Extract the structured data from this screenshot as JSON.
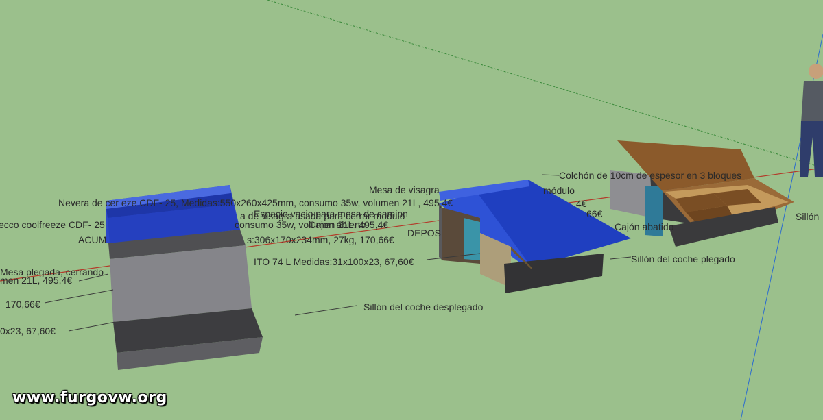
{
  "labels": {
    "nevera": "Nevera de          cer                    eze CDF- 25, Medidas:550x260x425mm, consumo 35w, volumen 21L, 495,4€",
    "nevera2": "ecco coolfreeze CDF- 25",
    "consumo": "consumo 35w, volumen 21L,  495,4€",
    "acum": "ACUM",
    "acum_medidas": "s:306x170x234mm, 27kg,  170,66€",
    "deposito": "ITO 74 L Medidas:31x100x23, 67,60€",
    "mesa_plegada": "Mesa plegada, cerrando",
    "volumen_left": "men 21L,  495,4€",
    "precio_170": "170,66€",
    "precio_67": "0x23, 67,60€",
    "sillon_desplegado": "Sillón del coche desplegado",
    "mesa_visagra": "Mesa de visagra",
    "espacio_vacio": "Espacio vacio para mesa de camion",
    "visagra_usada": "a de visagra usada para cerrar modulo",
    "cajon_abierto": "Cajon abierto",
    "depos": "DEPOS",
    "colchon": "Colchón de 10cm de espesor en 3 bloques",
    "modulo": "módulo",
    "sillon_plegado": "Sillón del coche plegado",
    "cajon_right": "Cajón abatido",
    "sillon_right": "Sillón",
    "precio_4": "4€",
    "precio_66": "66€",
    "watermark": "www.furgovw.org"
  },
  "colors": {
    "ground": "#9bc08c",
    "mattress": "#1f3fbf",
    "module_gray": "#7c7c80",
    "wood": "#8a5a30"
  }
}
